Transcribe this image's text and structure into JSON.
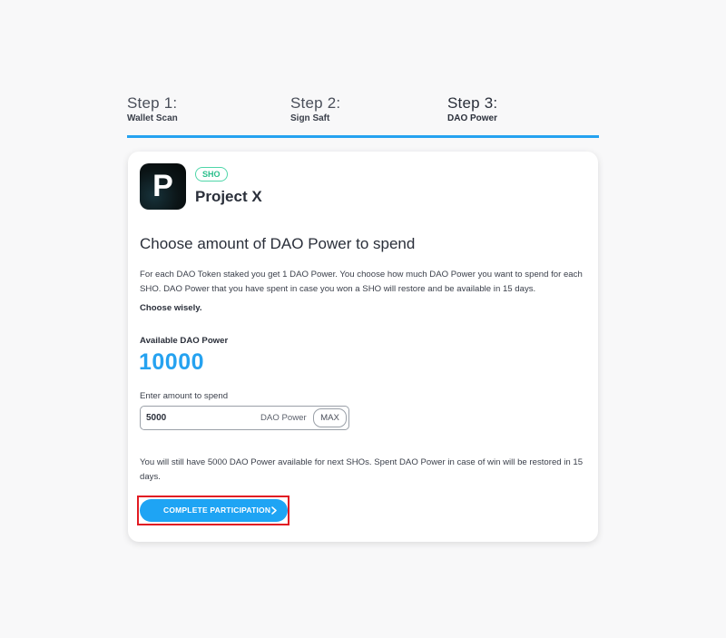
{
  "steps": [
    {
      "title": "Step 1:",
      "subtitle": "Wallet Scan"
    },
    {
      "title": "Step 2:",
      "subtitle": "Sign Saft"
    },
    {
      "title": "Step 3:",
      "subtitle": "DAO Power",
      "active": true
    }
  ],
  "colors": {
    "accent": "#25a2f0",
    "badge": "#2bbf8c",
    "highlight": "#e11b23"
  },
  "project": {
    "logo_letter": "P",
    "badge": "SHO",
    "name": "Project X"
  },
  "content": {
    "heading": "Choose amount of DAO Power to spend",
    "description": "For each DAO Token staked you get 1 DAO Power. You choose how much DAO Power you want to spend for each SHO. DAO Power that you have spent in case you won a SHO will restore and be available in 15 days.",
    "emphasis": "Choose wisely.",
    "available_label": "Available DAO Power",
    "available_value": "10000",
    "enter_label": "Enter amount to spend",
    "amount_value": "5000",
    "amount_unit": "DAO Power",
    "max_label": "MAX",
    "remaining_text": "You will still have 5000 DAO Power available for next SHOs. Spent DAO Power in case of win will be restored in 15 days.",
    "cta_label": "COMPLETE PARTICIPATION",
    "cta_icon": "chevron-right-icon"
  }
}
